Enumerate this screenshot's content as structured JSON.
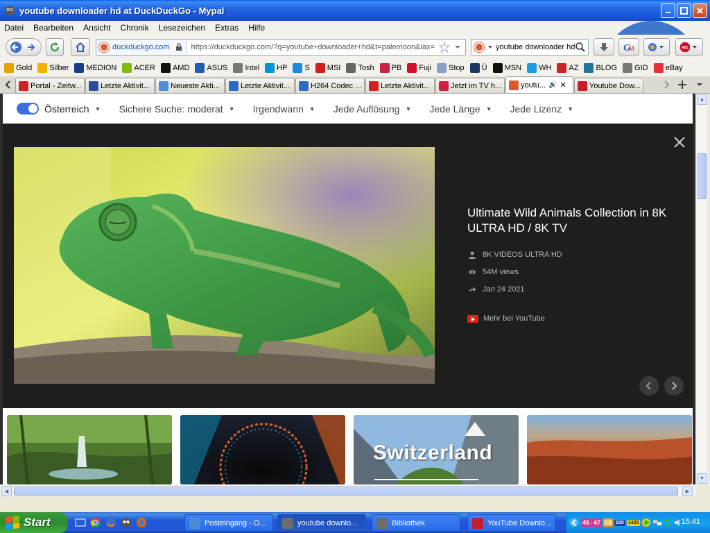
{
  "window": {
    "title": "youtube downloader hd at DuckDuckGo - Mypal"
  },
  "menu": [
    "Datei",
    "Bearbeiten",
    "Ansicht",
    "Chronik",
    "Lesezeichen",
    "Extras",
    "Hilfe"
  ],
  "navbar": {
    "site": "duckduckgo.com",
    "url": "https://duckduckgo.com/?q=youtube+downloader+hd&t=palemoon&iax=",
    "search_value": "youtube downloader hd"
  },
  "bookmarks": [
    {
      "label": "Gold",
      "color": "#e6a100"
    },
    {
      "label": "Silber",
      "color": "#f0b400"
    },
    {
      "label": "MEDION",
      "color": "#1a3c8c"
    },
    {
      "label": "ACER",
      "color": "#83b81a"
    },
    {
      "label": "AMD",
      "color": "#111111"
    },
    {
      "label": "ASUS",
      "color": "#1f5fb3"
    },
    {
      "label": "Intel",
      "color": "#777777"
    },
    {
      "label": "HP",
      "color": "#0096d6"
    },
    {
      "label": "S",
      "color": "#1e88e5"
    },
    {
      "label": "MSI",
      "color": "#d11f1f"
    },
    {
      "label": "Tosh",
      "color": "#666666"
    },
    {
      "label": "PB",
      "color": "#cc2244"
    },
    {
      "label": "Fuji",
      "color": "#d3122a"
    },
    {
      "label": "Stop",
      "color": "#8aa0c8"
    },
    {
      "label": "Ü",
      "color": "#1b3b5e"
    },
    {
      "label": "MSN",
      "color": "#111111"
    },
    {
      "label": "WH",
      "color": "#1e9be0"
    },
    {
      "label": "AZ",
      "color": "#cc2222"
    },
    {
      "label": "BLOG",
      "color": "#21759b"
    },
    {
      "label": "GID",
      "color": "#777777"
    },
    {
      "label": "eBay",
      "color": "#e53238"
    }
  ],
  "tabs": [
    {
      "label": "Portal - Zeitw...",
      "color": "#cc2222"
    },
    {
      "label": "Letzte Aktivit...",
      "color": "#2b4f9a"
    },
    {
      "label": "Neueste Akti...",
      "color": "#4a90d9"
    },
    {
      "label": "Letzte Aktivit...",
      "color": "#2b6cc4"
    },
    {
      "label": "H264 Codec ...",
      "color": "#2b6cc4"
    },
    {
      "label": "Letzte Aktivit...",
      "color": "#d42020"
    },
    {
      "label": "Jetzt im TV h...",
      "color": "#d02040"
    },
    {
      "label": "youtu...",
      "color": "#de5833",
      "active": true
    },
    {
      "label": "Youtube Dow...",
      "color": "#c81e2c"
    }
  ],
  "filters": {
    "region": "Österreich",
    "safe_search": "Sichere Suche: moderat",
    "time": "Irgendwann",
    "resolution": "Jede Auflösung",
    "length": "Jede Länge",
    "license": "Jede Lizenz"
  },
  "video": {
    "title": "Ultimate Wild Animals Collection in 8K ULTRA HD / 8K TV",
    "channel": "8K VIDEOS ULTRA HD",
    "views": "54M views",
    "date": "Jan 24 2021",
    "more_link": "Mehr bei YouTube"
  },
  "thumbnails": [
    {
      "name": "forest-waterfall",
      "overlay": ""
    },
    {
      "name": "dark-ring",
      "overlay": ""
    },
    {
      "name": "switzerland",
      "overlay": "Switzerland"
    },
    {
      "name": "red-desert",
      "overlay": ""
    }
  ],
  "taskbar": {
    "start_label": "Start",
    "buttons": [
      {
        "label": "Posteingang - O...",
        "color": "#4e8ad6"
      },
      {
        "label": "youtube downlo...",
        "color": "#6d6d6d",
        "active": true
      },
      {
        "label": "Bibliothek",
        "color": "#6d6d6d"
      },
      {
        "label": "YouTube Downlo...",
        "color": "#c81e2c"
      }
    ],
    "tray_badges": [
      "45",
      "47",
      "58",
      "100",
      "1425"
    ],
    "clock": "15:41"
  }
}
